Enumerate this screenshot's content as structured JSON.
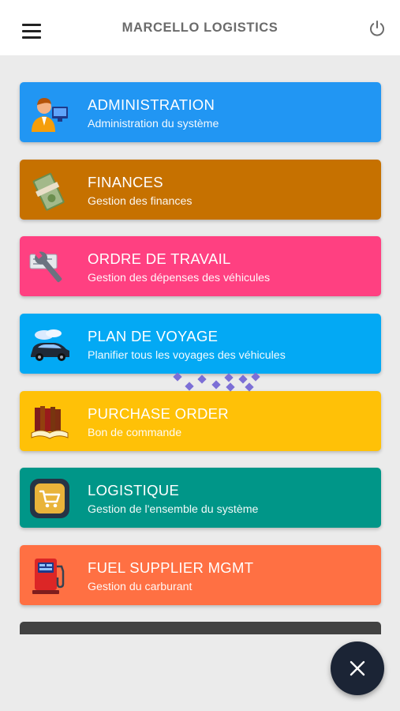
{
  "header": {
    "title": "MARCELLO LOGISTICS",
    "menu_icon": "hamburger-menu-icon",
    "power_icon": "power-icon"
  },
  "modules": [
    {
      "title": "ADMINISTRATION",
      "subtitle": "Administration du système",
      "color": "#2196f3",
      "icon": "administrator-icon"
    },
    {
      "title": "FINANCES",
      "subtitle": "Gestion des finances",
      "color": "#c67100",
      "icon": "money-icon"
    },
    {
      "title": "ORDRE DE TRAVAIL",
      "subtitle": "Gestion des dépenses des véhicules",
      "color": "#ff4081",
      "icon": "wrench-icon"
    },
    {
      "title": "PLAN DE VOYAGE",
      "subtitle": "Planifier tous les voyages des véhicules",
      "color": "#03a9f4",
      "icon": "car-icon"
    },
    {
      "title": "PURCHASE ORDER",
      "subtitle": "Bon de commande",
      "color": "#ffc107",
      "icon": "books-icon"
    },
    {
      "title": "LOGISTIQUE",
      "subtitle": "Gestion de l'ensemble du système",
      "color": "#009688",
      "icon": "shopping-cart-icon"
    },
    {
      "title": "FUEL SUPPLIER MGMT",
      "subtitle": "Gestion du carburant",
      "color": "#ff7043",
      "icon": "fuel-pump-icon"
    }
  ],
  "fab": {
    "icon": "close-icon",
    "color": "#1b2435"
  }
}
